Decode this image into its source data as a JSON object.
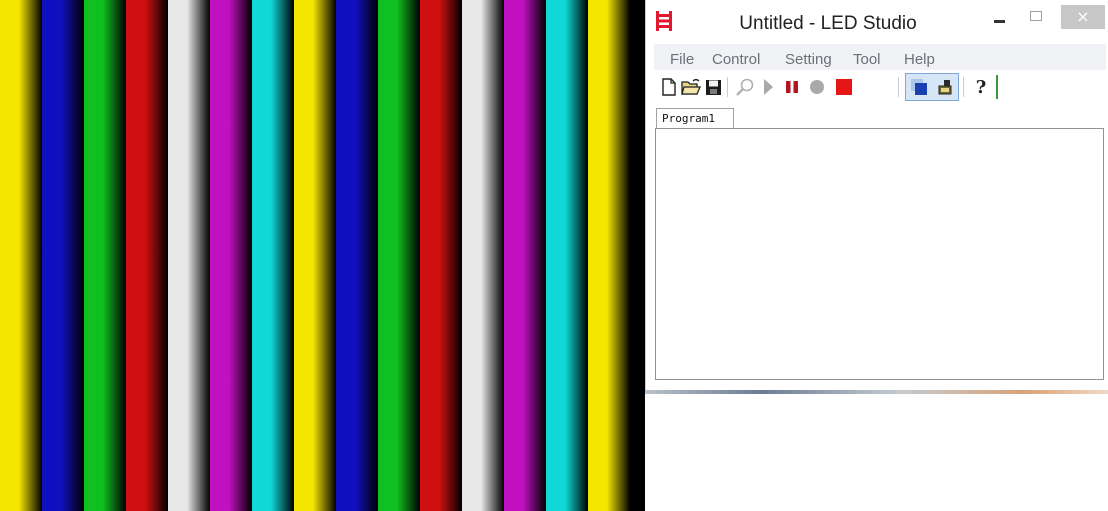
{
  "window": {
    "title": "Untitled - LED Studio",
    "close_glyph": "×"
  },
  "menu": {
    "items": [
      "File",
      "Control",
      "Setting",
      "Tool",
      "Help"
    ]
  },
  "toolbar": {
    "buttons": [
      "new-file-icon",
      "open-folder-icon",
      "save-icon",
      "find-icon",
      "play-icon",
      "pause-icon",
      "record-icon",
      "stop-icon",
      "display-window-icon",
      "lock-display-icon",
      "help-icon"
    ],
    "help_glyph": "?"
  },
  "tabs": [
    {
      "label": "Program1",
      "active": true
    }
  ],
  "preview": {
    "bar_colors": [
      "#f5e600",
      "#1010c0",
      "#10c020",
      "#d01010",
      "#e8e8e8",
      "#c010c0",
      "#10d8d8",
      "#f5e600",
      "#1010c0",
      "#10c020",
      "#d01010",
      "#e8e8e8",
      "#c010c0",
      "#10d8d8",
      "#f5e600"
    ]
  },
  "colors": {
    "logo_red": "#e0192f",
    "stop_red": "#e51616",
    "pause_red": "#b4141e",
    "play_gray": "#a9a9a9",
    "toolbar_blue": "#1a3fb0"
  }
}
